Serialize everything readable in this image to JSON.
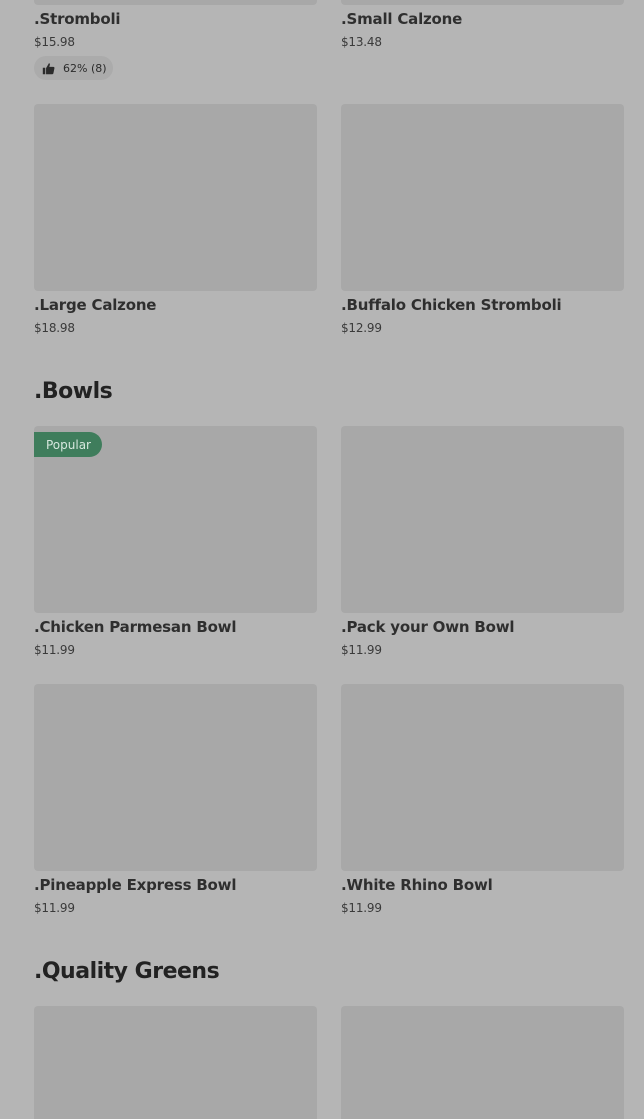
{
  "top_row": [
    {
      "name": ".Stromboli",
      "price": "$15.98",
      "rating": "62% (8)"
    },
    {
      "name": ".Small Calzone",
      "price": "$13.48"
    }
  ],
  "row2": [
    {
      "name": ".Large Calzone",
      "price": "$18.98"
    },
    {
      "name": ".Buffalo Chicken Stromboli",
      "price": "$12.99"
    }
  ],
  "sections": {
    "bowls": {
      "title": ".Bowls"
    },
    "greens": {
      "title": ".Quality Greens"
    }
  },
  "bowls_row1": [
    {
      "name": ".Chicken Parmesan Bowl",
      "price": "$11.99",
      "badge": "Popular"
    },
    {
      "name": ".Pack your Own Bowl",
      "price": "$11.99"
    }
  ],
  "bowls_row2": [
    {
      "name": ".Pineapple Express Bowl",
      "price": "$11.99"
    },
    {
      "name": ".White Rhino Bowl",
      "price": "$11.99"
    }
  ],
  "icons": {
    "rating": "thumbs-up-icon"
  },
  "colors": {
    "background": "#b5b5b5",
    "image_placeholder": "#a8a8a8",
    "badge": "#3f7d5c"
  }
}
